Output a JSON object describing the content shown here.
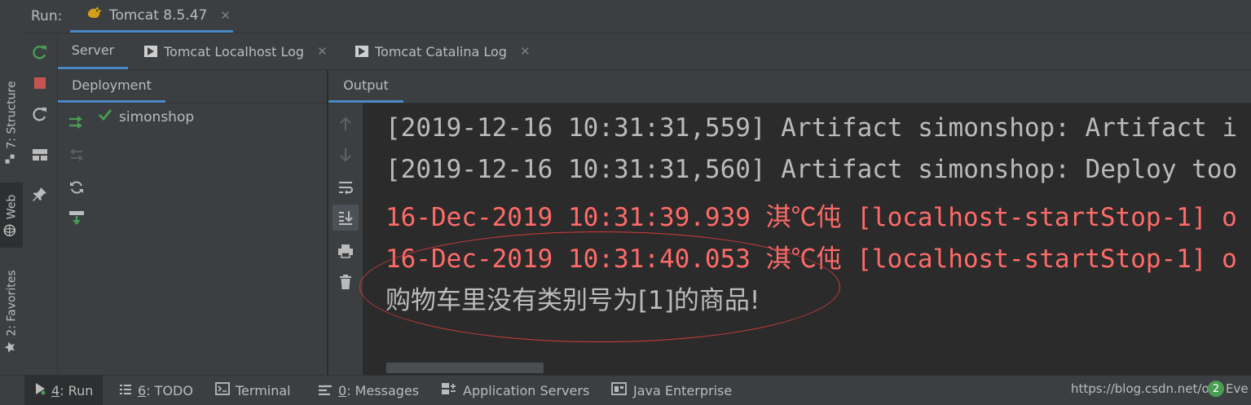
{
  "run_header": {
    "label": "Run:",
    "tab_title": "Tomcat 8.5.47"
  },
  "left_strip": {
    "structure": "7: Structure",
    "web": "Web",
    "favorites": "2: Favorites"
  },
  "inner_tabs": [
    {
      "label": "Server"
    },
    {
      "label": "Tomcat Localhost Log"
    },
    {
      "label": "Tomcat Catalina Log"
    }
  ],
  "deployment": {
    "tab": "Deployment",
    "item": "simonshop"
  },
  "output": {
    "tab": "Output",
    "lines": [
      "[2019-12-16 10:31:31,559] Artifact simonshop: Artifact i",
      "[2019-12-16 10:31:31,560] Artifact simonshop: Deploy too",
      "16-Dec-2019 10:31:39.939 淇℃伅 [localhost-startStop-1] o",
      "16-Dec-2019 10:31:40.053 淇℃伅 [localhost-startStop-1] o",
      "购物车里没有类别号为[1]的商品!"
    ]
  },
  "status_bar": {
    "run_num": "4",
    "run": ": Run",
    "todo_num": "6",
    "todo": ": TODO",
    "terminal": "Terminal",
    "messages_num": "0",
    "messages": ": Messages",
    "app_servers": "Application Servers",
    "java_enterprise": "Java Enterprise",
    "url": "https://blog.csdn.net/ove",
    "event_badge": "2",
    "event_text": "Eve"
  },
  "colors": {
    "accent": "#4a88c7",
    "error_text": "#ff6b68",
    "run_green": "#499c54",
    "stop_red": "#c75450",
    "annotation": "#d23b3b"
  },
  "icons": [
    "rerun-icon",
    "stop-icon",
    "restart-icon",
    "layout-icon",
    "pin-icon",
    "deploy-icon",
    "undeploy-icon",
    "refresh-icon",
    "update-icon",
    "check-icon",
    "up-arrow-icon",
    "down-arrow-icon",
    "soft-wrap-icon",
    "scroll-to-end-icon",
    "print-icon",
    "trash-icon",
    "globe-icon",
    "star-icon",
    "structure-icon",
    "tomcat-icon",
    "play-icon",
    "list-icon",
    "terminal-icon",
    "messages-icon",
    "servers-icon",
    "java-enterprise-icon"
  ]
}
